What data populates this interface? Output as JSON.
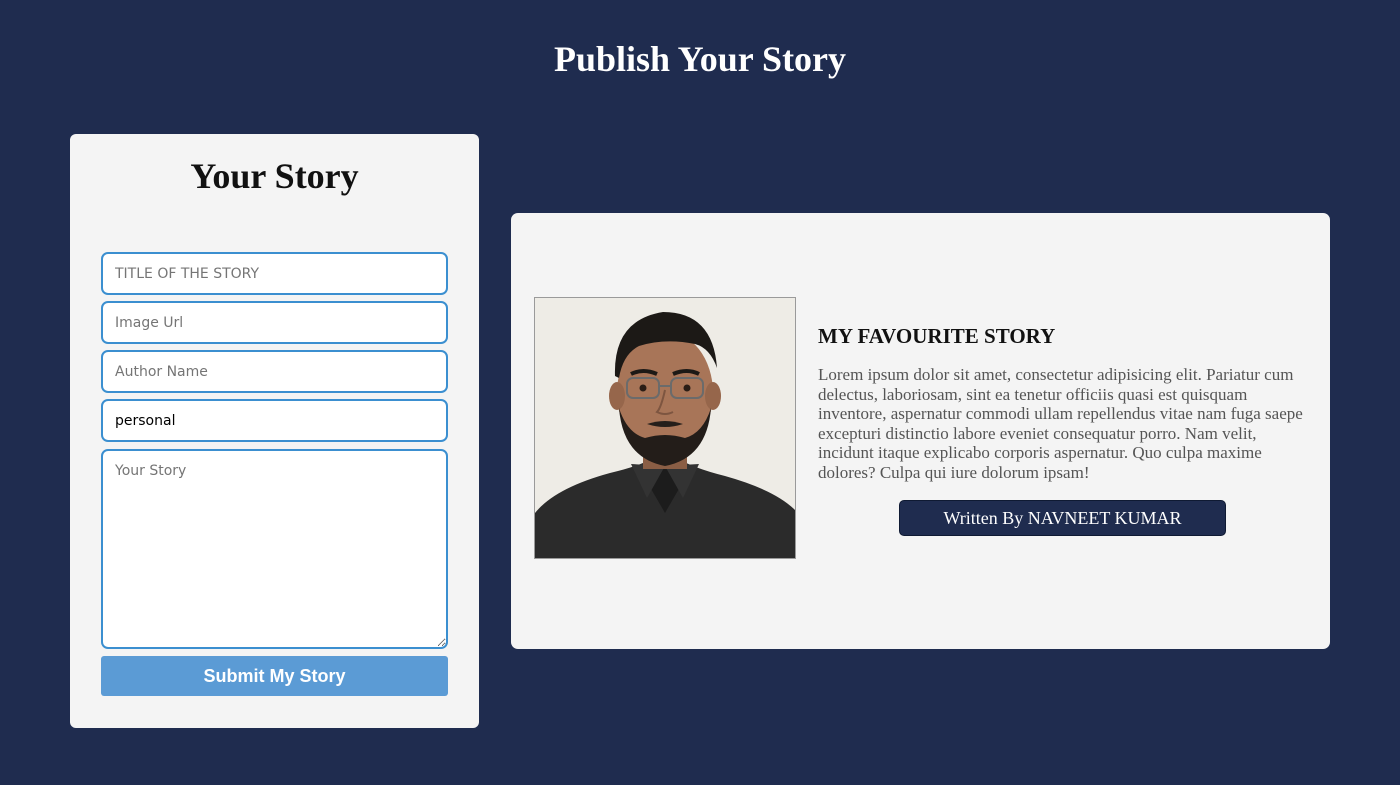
{
  "header": {
    "title": "Publish Your Story"
  },
  "form": {
    "heading": "Your Story",
    "title_placeholder": "TITLE OF THE STORY",
    "image_placeholder": "Image Url",
    "author_placeholder": "Author Name",
    "category_value": "personal",
    "story_placeholder": "Your Story",
    "submit_label": "Submit My Story"
  },
  "story": {
    "title": "MY FAVOURITE STORY",
    "body": "Lorem ipsum dolor sit amet, consectetur adipisicing elit. Pariatur cum delectus, laboriosam, sint ea tenetur officiis quasi est quisquam inventore, aspernatur commodi ullam repellendus vitae nam fuga saepe excepturi distinctio labore eveniet consequatur porro. Nam velit, incidunt itaque explicabo corporis aspernatur. Quo culpa maxime dolores? Culpa qui iure dolorum ipsam!",
    "author_button": "Written By NAVNEET KUMAR"
  },
  "colors": {
    "page_background": "#1f2c4f",
    "card_background": "#f4f4f4",
    "input_border": "#3b8fd0",
    "submit_button": "#5b9bd5",
    "author_button": "#1f2c4f"
  }
}
